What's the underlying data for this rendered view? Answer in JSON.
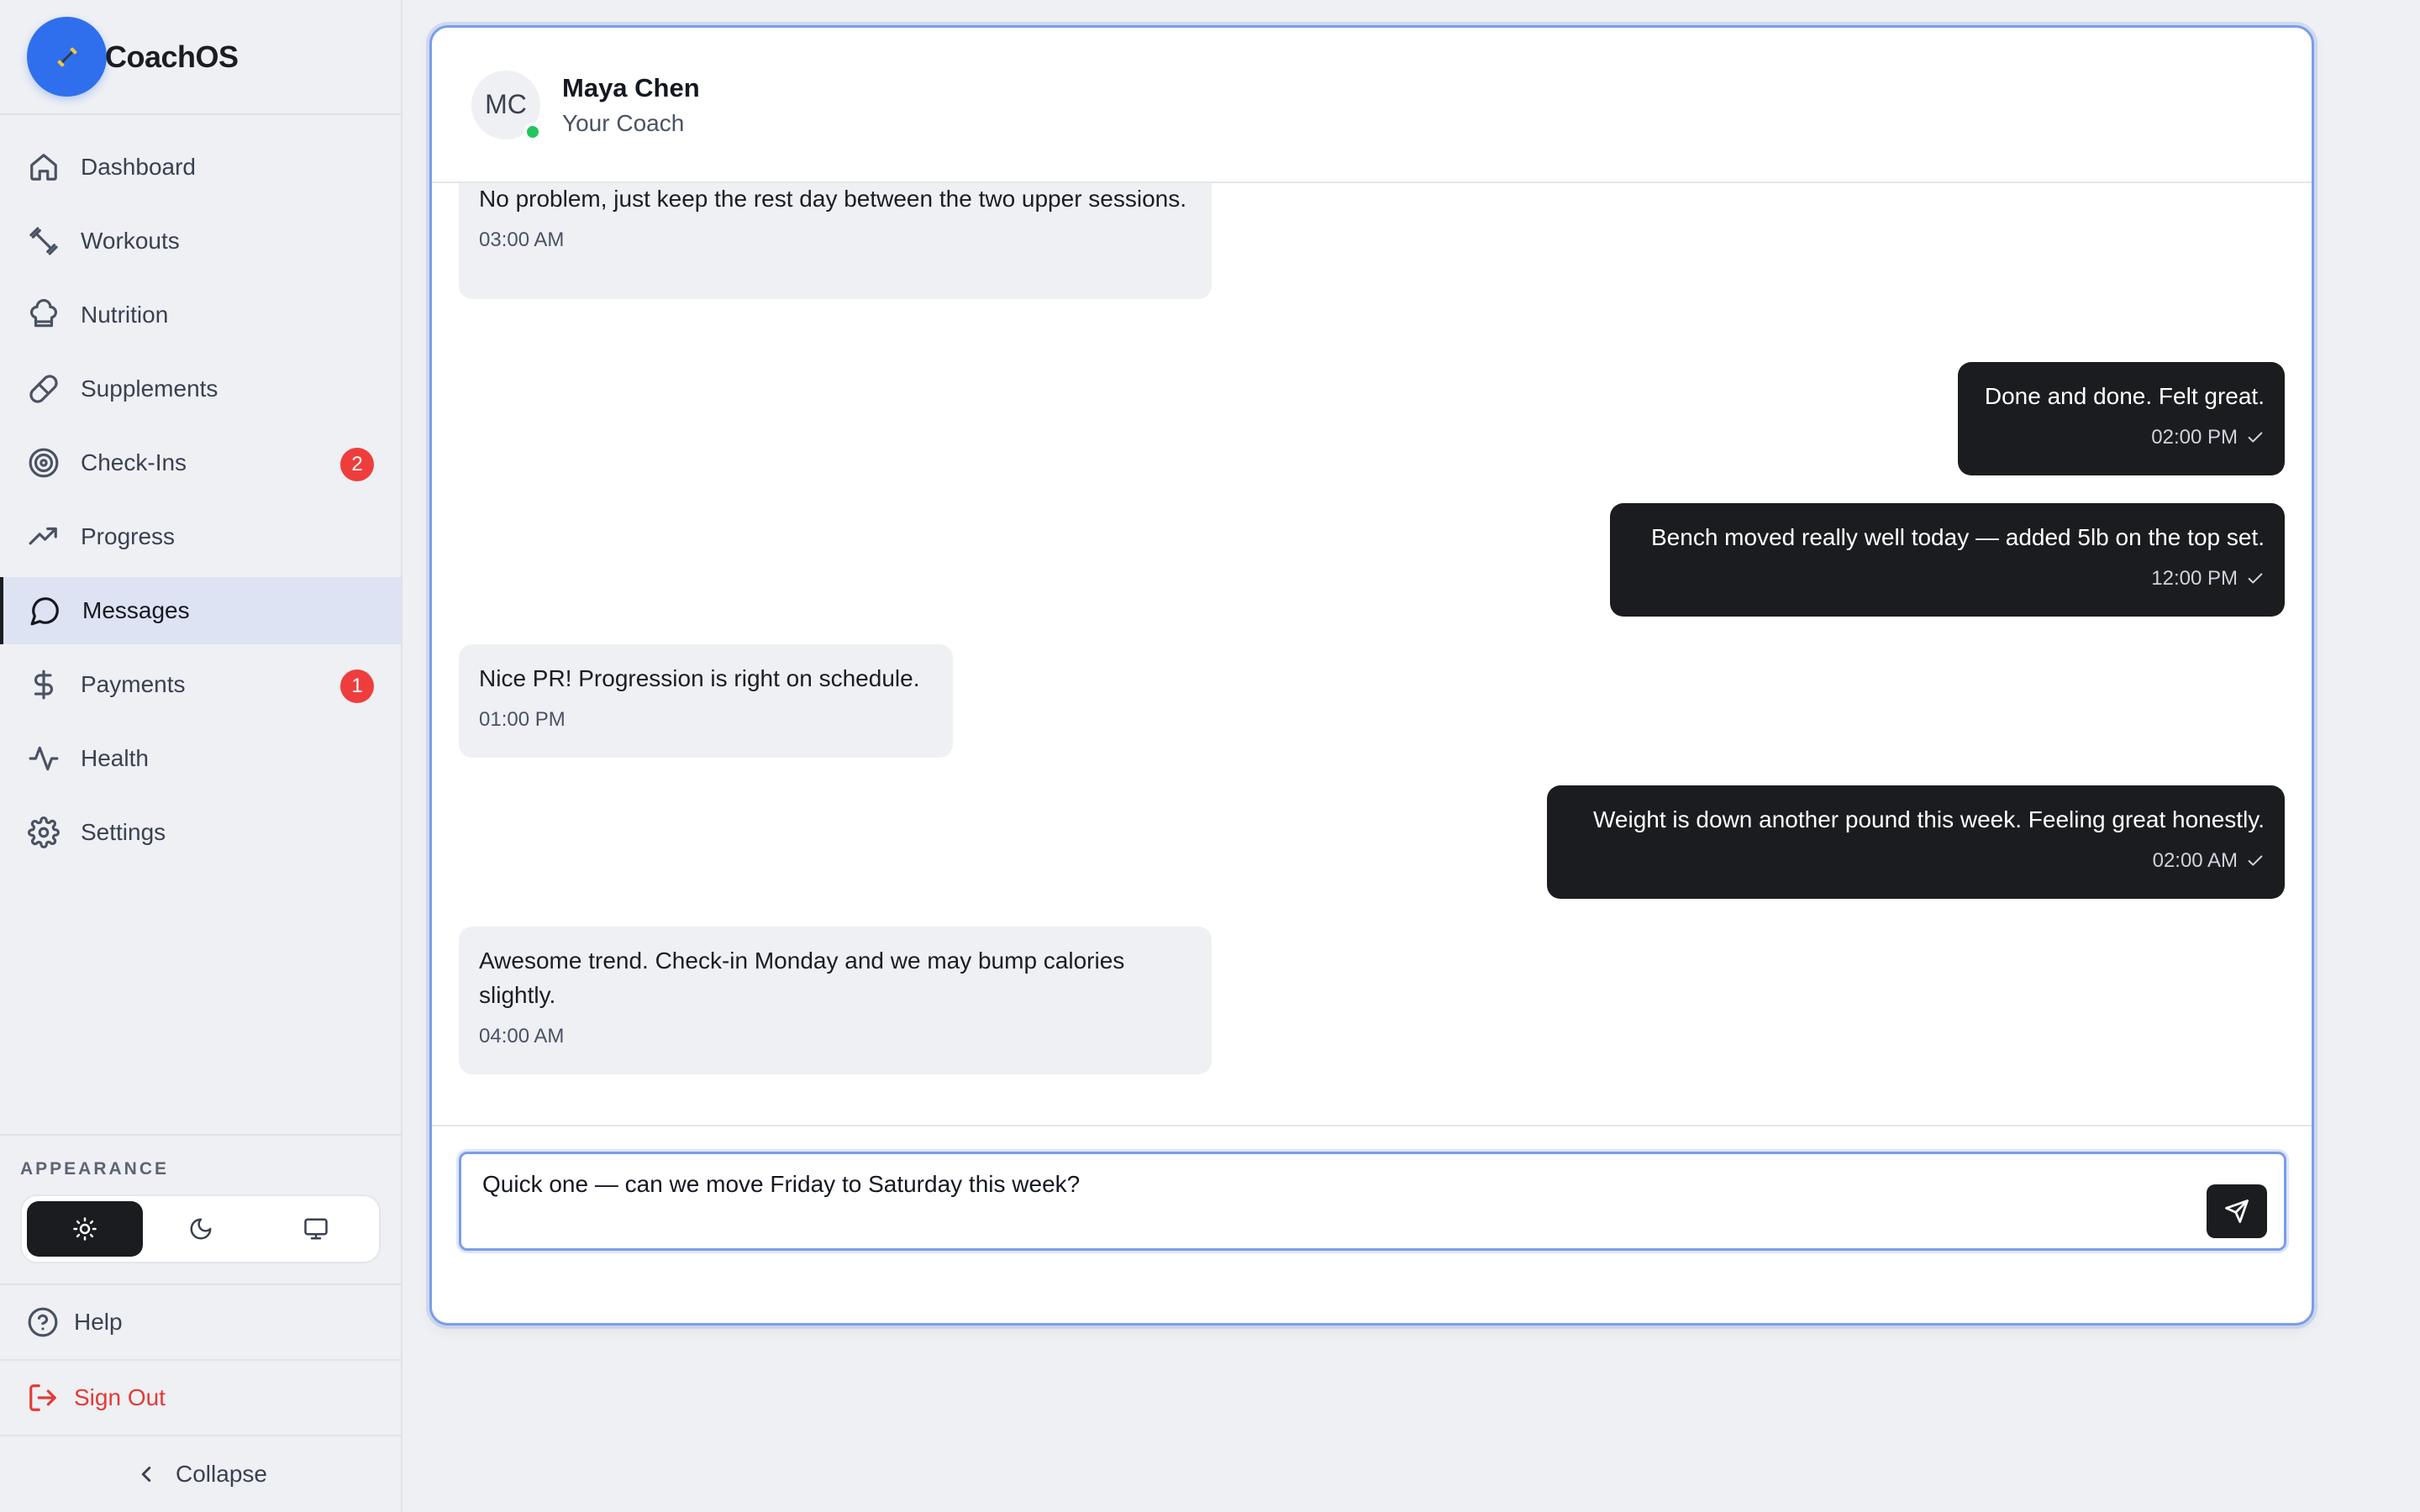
{
  "app": {
    "name": "CoachOS"
  },
  "sidebar": {
    "items": [
      {
        "label": "Dashboard",
        "icon": "home-icon"
      },
      {
        "label": "Workouts",
        "icon": "dumbbell-icon"
      },
      {
        "label": "Nutrition",
        "icon": "chef-hat-icon"
      },
      {
        "label": "Supplements",
        "icon": "pill-icon"
      },
      {
        "label": "Check-Ins",
        "icon": "target-icon",
        "badge": "2"
      },
      {
        "label": "Progress",
        "icon": "trending-up-icon"
      },
      {
        "label": "Messages",
        "icon": "message-circle-icon",
        "active": true
      },
      {
        "label": "Payments",
        "icon": "dollar-icon",
        "badge": "1"
      },
      {
        "label": "Health",
        "icon": "activity-icon"
      },
      {
        "label": "Settings",
        "icon": "gear-icon"
      }
    ],
    "appearance_label": "APPEARANCE",
    "theme_options": [
      "light",
      "dark",
      "system"
    ],
    "theme_selected": "light",
    "help_label": "Help",
    "signout_label": "Sign Out",
    "collapse_label": "Collapse"
  },
  "chat": {
    "coach_initials": "MC",
    "coach_name": "Maya Chen",
    "coach_role": "Your Coach",
    "coach_status": "online",
    "messages": [
      {
        "from": "coach",
        "text": "No problem, just keep the rest day between the two upper sessions.",
        "time": "03:00 AM"
      },
      {
        "from": "me",
        "text": "Done and done. Felt great.",
        "time": "02:00 PM"
      },
      {
        "from": "me",
        "text": "Bench moved really well today — added 5lb on the top set.",
        "time": "12:00 PM"
      },
      {
        "from": "coach",
        "text": "Nice PR! Progression is right on schedule.",
        "time": "01:00 PM"
      },
      {
        "from": "me",
        "text": "Weight is down another pound this week. Feeling great honestly.",
        "time": "02:00 AM"
      },
      {
        "from": "coach",
        "text": "Awesome trend. Check-in Monday and we may bump calories slightly.",
        "time": "04:00 AM"
      }
    ],
    "composer_value": "Quick one — can we move Friday to Saturday this week?"
  },
  "colors": {
    "accent": "#2f6fed",
    "focus_ring": "#7a9de8",
    "badge": "#ef3d3d",
    "danger": "#e53935",
    "online": "#22c55e",
    "outgoing_bubble": "#1b1c20",
    "incoming_bubble": "#eef0f4"
  }
}
